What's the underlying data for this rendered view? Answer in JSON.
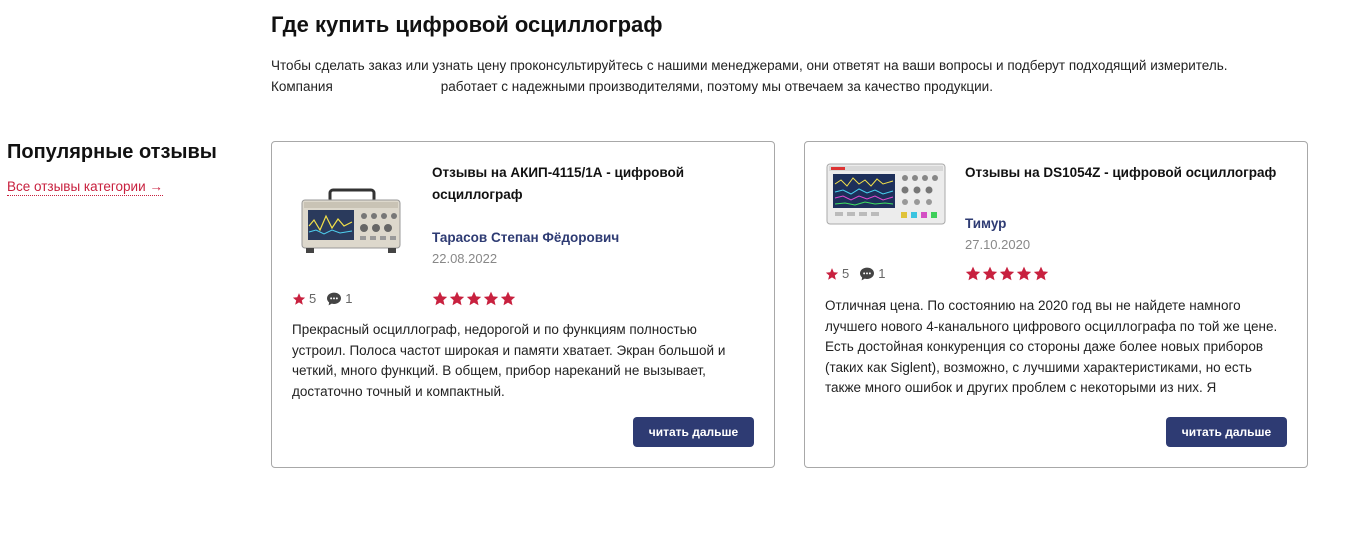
{
  "buy_section": {
    "title": "Где купить цифровой осциллограф",
    "text_line1": "Чтобы сделать заказ или узнать цену проконсультируйтесь с нашими менеджерами, они ответят на ваши вопросы и подберут подходящий измеритель.",
    "text_line2_start": "Компания",
    "text_line2_end": "работает с надежными производителями, поэтому мы отвечаем за качество продукции."
  },
  "sidebar": {
    "title": "Популярные отзывы",
    "all_reviews_link": "Все отзывы категории →"
  },
  "colors": {
    "accent": "#c8213f",
    "button_bg": "#2e3b73",
    "author": "#2e3b73"
  },
  "reviews": [
    {
      "title": "Отзывы на АКИП-4115/1А - цифровой осциллограф",
      "author": "Тарасов Степан Фёдорович",
      "date": "22.08.2022",
      "rating": "5",
      "comments": "1",
      "stars": 5,
      "text": "Прекрасный осциллограф, недорогой и по функциям полностью устроил. Полоса частот широкая и памяти хватает. Экран большой и четкий, много функций. В общем, прибор нареканий не вызывает, достаточно точный и компактный.",
      "button": "читать дальше"
    },
    {
      "title": "Отзывы на DS1054Z - цифровой осциллограф",
      "author": "Тимур",
      "date": "27.10.2020",
      "rating": "5",
      "comments": "1",
      "stars": 5,
      "text": "Отличная цена. По состоянию на 2020 год вы не найдете намного лучшего нового 4-канального цифрового осциллографа по той же цене. Есть достойная конкуренция со стороны даже более новых приборов (таких как Siglent), возможно, с лучшими характеристиками, но есть также много ошибок и других проблем с некоторыми из них. Я",
      "button": "читать дальше"
    }
  ]
}
